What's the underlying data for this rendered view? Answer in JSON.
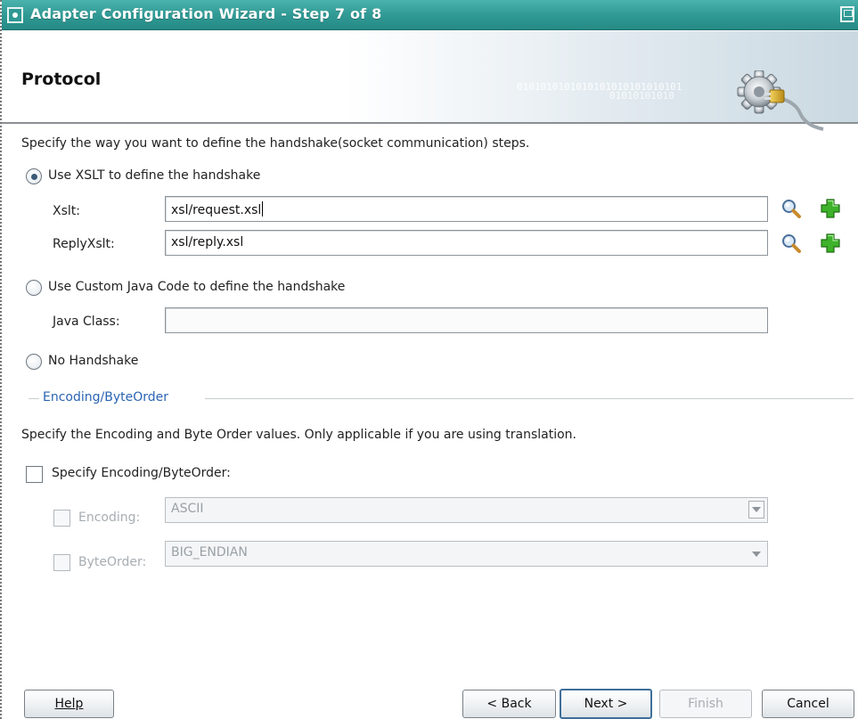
{
  "window": {
    "title": "Adapter Configuration Wizard - Step 7 of 8"
  },
  "header": {
    "page_title": "Protocol",
    "binary_line1": "0101010101010101010101010101",
    "binary_line2": "01010101010"
  },
  "content": {
    "description": "Specify the way you want to define the handshake(socket communication) steps.",
    "options": {
      "xslt": {
        "label": "Use XSLT to define the handshake",
        "selected": true,
        "xslt_label": "Xslt:",
        "xslt_value": "xsl/request.xsl",
        "reply_label": "ReplyXslt:",
        "reply_value": "xsl/reply.xsl"
      },
      "java": {
        "label": "Use Custom Java Code to define the handshake",
        "selected": false,
        "class_label": "Java Class:",
        "class_value": ""
      },
      "none": {
        "label": "No Handshake",
        "selected": false
      }
    },
    "encoding_section": {
      "legend": "Encoding/ByteOrder",
      "description": "Specify the Encoding and Byte Order values. Only applicable if you are using translation.",
      "specify_label": "Specify Encoding/ByteOrder:",
      "specify_checked": false,
      "encoding_label": "Encoding:",
      "encoding_value": "ASCII",
      "byteorder_label": "ByteOrder:",
      "byteorder_value": "BIG_ENDIAN"
    }
  },
  "footer": {
    "help": "Help",
    "back": "< Back",
    "next": "Next >",
    "finish": "Finish",
    "cancel": "Cancel"
  },
  "icons": {
    "browse": "magnifier-icon",
    "add": "green-plus-icon"
  },
  "colors": {
    "titlebar": "#2f9893",
    "legend": "#2a64b2",
    "add_icon": "#2e9e1f"
  }
}
